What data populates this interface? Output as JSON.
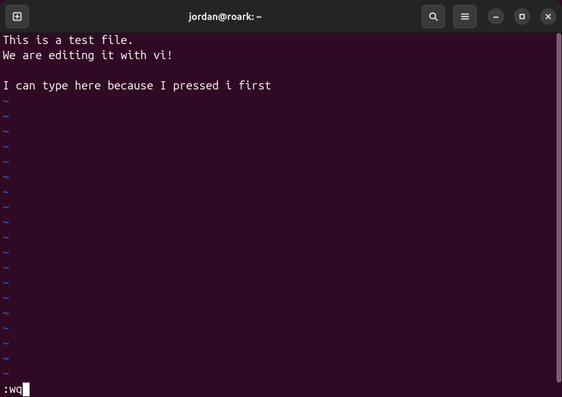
{
  "window": {
    "title": "jordan@roark: ~"
  },
  "icons": {
    "new_tab": "new-tab-icon",
    "search": "search-icon",
    "menu": "hamburger-icon",
    "minimize": "minimize-icon",
    "maximize": "maximize-icon",
    "close": "close-icon"
  },
  "editor": {
    "lines": [
      "This is a test file.",
      "We are editing it with vi!",
      "",
      "I can type here because I pressed i first"
    ],
    "tilde": "~",
    "command_line": ":wq"
  },
  "colors": {
    "bg": "#300a24",
    "titlebar": "#242424",
    "text": "#ffffff",
    "tilde": "#3a6bff"
  }
}
